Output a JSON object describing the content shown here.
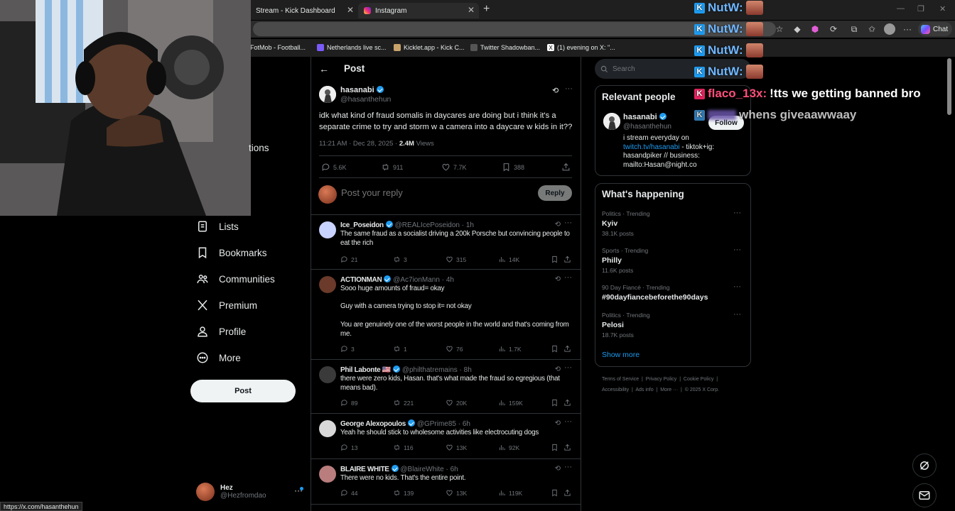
{
  "browser": {
    "tabs": [
      {
        "label": "Stream - Kick Dashboard"
      },
      {
        "label": "Instagram"
      }
    ],
    "chat_button": "Chat",
    "bookmarks": [
      {
        "label": "FotMob - Football..."
      },
      {
        "label": "Netherlands live sc..."
      },
      {
        "label": "Kicklet.app - Kick C..."
      },
      {
        "label": "Twitter Shadowban..."
      },
      {
        "label": "(1) evening on X: \"..."
      }
    ],
    "status_url": "https://x.com/hasanthehun"
  },
  "nav": {
    "partial_label": "tions",
    "items": [
      {
        "label": "Lists",
        "icon": "lists-icon"
      },
      {
        "label": "Bookmarks",
        "icon": "bookmark-icon"
      },
      {
        "label": "Communities",
        "icon": "communities-icon"
      },
      {
        "label": "Premium",
        "icon": "x-logo-icon"
      },
      {
        "label": "Profile",
        "icon": "profile-icon"
      },
      {
        "label": "More",
        "icon": "more-circle-icon"
      }
    ],
    "post_button": "Post",
    "account": {
      "name": "Hez",
      "handle": "@Hezfromdao"
    }
  },
  "post": {
    "header_title": "Post",
    "author": {
      "name": "hasanabi",
      "handle": "@hasanthehun"
    },
    "text": "idk what kind of fraud somalis in daycares are doing but i think it's a separate crime to try and storm w a camera into a daycare w kids in it??",
    "time": "11:21 AM · Dec 28, 2025 · ",
    "views_count": "2.4M",
    "views_label": " Views",
    "stats": {
      "replies": "5.6K",
      "reposts": "911",
      "likes": "7.7K",
      "bookmarks": "388"
    },
    "reply_placeholder": "Post your reply",
    "reply_button": "Reply"
  },
  "replies": [
    {
      "name": "Ice_Poseidon",
      "handle": "@REALIcePoseidon · 1h",
      "text": "The same fraud as a socialist driving a 200k Porsche but convincing people to eat the rich",
      "replies": "21",
      "reposts": "3",
      "likes": "315",
      "views": "14K"
    },
    {
      "name": "ACTIONMAN",
      "handle": "@Ac7ionMann · 4h",
      "text": "Sooo huge amounts of fraud= okay\n\nGuy with a camera trying to stop it= not okay\n\nYou are genuinely one of the worst people in the world and that's coming from me.",
      "replies": "3",
      "reposts": "1",
      "likes": "76",
      "views": "1.7K"
    },
    {
      "name": "Phil Labonte 🇺🇸",
      "handle": "@philthatremains · 8h",
      "text": "there were zero kids, Hasan. that's what made the fraud so egregious (that means bad).",
      "replies": "89",
      "reposts": "221",
      "likes": "20K",
      "views": "159K"
    },
    {
      "name": "George Alexopoulos",
      "handle": "@GPrime85 · 6h",
      "text": "Yeah he should stick to wholesome activities like electrocuting dogs",
      "replies": "13",
      "reposts": "116",
      "likes": "13K",
      "views": "92K"
    },
    {
      "name": "BLAIRE WHITE",
      "handle": "@BlaireWhite · 6h",
      "text": "There were no kids. That's the entire point.",
      "replies": "44",
      "reposts": "139",
      "likes": "13K",
      "views": "119K"
    }
  ],
  "sidebar": {
    "search_placeholder": "Search",
    "relevant_title": "Relevant people",
    "relevant": {
      "name": "hasanabi",
      "handle": "@hasanthehun",
      "follow": "Follow",
      "bio_1": "i stream everyday on ",
      "bio_link": "twitch.tv/hasanabi",
      "bio_2": " - tiktok+ig: hasandpiker // business: mailto:Hasan@night.co"
    },
    "happening_title": "What's happening",
    "trends": [
      {
        "context": "Politics · Trending",
        "topic": "Kyiv",
        "posts": "38.1K posts"
      },
      {
        "context": "Sports · Trending",
        "topic": "Philly",
        "posts": "11.6K posts"
      },
      {
        "context": "90 Day Fiancé · Trending",
        "topic": "#90dayfiancebeforethe90days",
        "posts": ""
      },
      {
        "context": "Politics · Trending",
        "topic": "Pelosi",
        "posts": "18.7K posts"
      }
    ],
    "show_more": "Show more",
    "footer_1": [
      "Terms of Service",
      "Privacy Policy",
      "Cookie Policy"
    ],
    "footer_2": [
      "Accessibility",
      "Ads info",
      "More ···",
      "© 2025 X Corp."
    ]
  },
  "chat_overlay": [
    {
      "user": "NutW:",
      "message": ""
    },
    {
      "user": "NutW:",
      "message": ""
    },
    {
      "user": "NutW:",
      "message": ""
    },
    {
      "user": "NutW:",
      "message": ""
    },
    {
      "user": "flaco_13x:",
      "message": "!tts we getting banned bro"
    },
    {
      "user": "",
      "message": "whens giveaawwaay"
    }
  ],
  "colors": {
    "accent": "#1d9bf0",
    "background": "#000000",
    "border": "#2f3336",
    "muted": "#71767b"
  }
}
